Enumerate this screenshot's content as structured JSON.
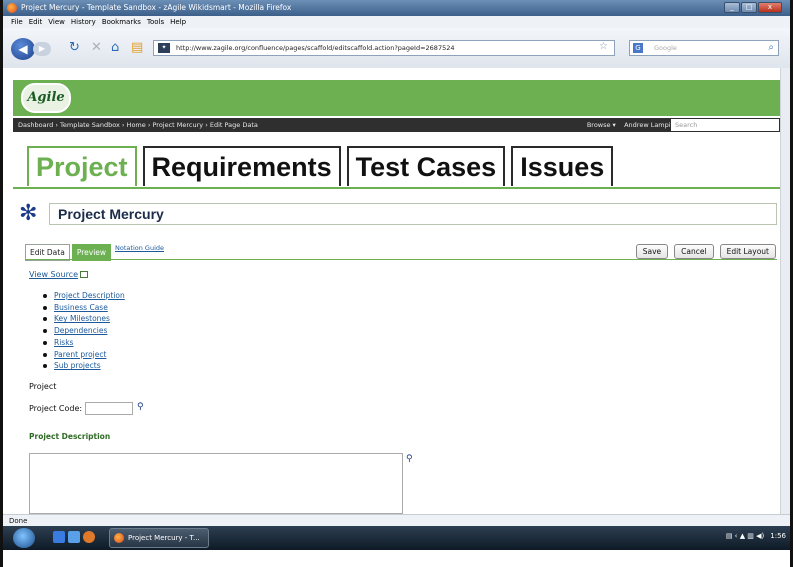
{
  "window": {
    "title": "Project Mercury - Template Sandbox - zAgile Wikidsmart - Mozilla Firefox",
    "controls": [
      "_",
      "□",
      "x"
    ]
  },
  "menu": [
    "File",
    "Edit",
    "View",
    "History",
    "Bookmarks",
    "Tools",
    "Help"
  ],
  "toolbar": {
    "url": "http://www.zagile.org/confluence/pages/scaffold/editscaffold.action?pageId=2687524",
    "search_placeholder": "Google"
  },
  "site": {
    "logo_text": "Agile",
    "breadcrumb": "Dashboard  ›  Template Sandbox  ›  Home  ›  Project Mercury  ›  Edit Page Data",
    "browse_label": "Browse ▾",
    "user_label": "Andrew Lampitt ▾",
    "search_placeholder": "Search"
  },
  "tabs": [
    "Project",
    "Requirements",
    "Test Cases",
    "Issues"
  ],
  "project": {
    "name": "Project Mercury"
  },
  "edit": {
    "tab_edit": "Edit Data",
    "tab_preview": "Preview",
    "notation_guide": "Notation Guide",
    "save": "Save",
    "cancel": "Cancel",
    "edit_layout": "Edit Layout"
  },
  "content": {
    "view_source": "View Source",
    "toc": [
      "Project Description",
      "Business Case",
      "Key Milestones",
      "Dependencies",
      "Risks",
      "Parent project",
      "Sub projects"
    ],
    "project_label": "Project",
    "project_code_label": "Project Code:",
    "project_description_heading": "Project Description"
  },
  "status": {
    "text": "Done"
  },
  "taskbar": {
    "item_label": "Project Mercury - T...",
    "clock": "1:56"
  },
  "colors": {
    "brand_green": "#6cb052",
    "dark_bar": "#2f2f2f",
    "link_blue": "#1c5a9b"
  }
}
